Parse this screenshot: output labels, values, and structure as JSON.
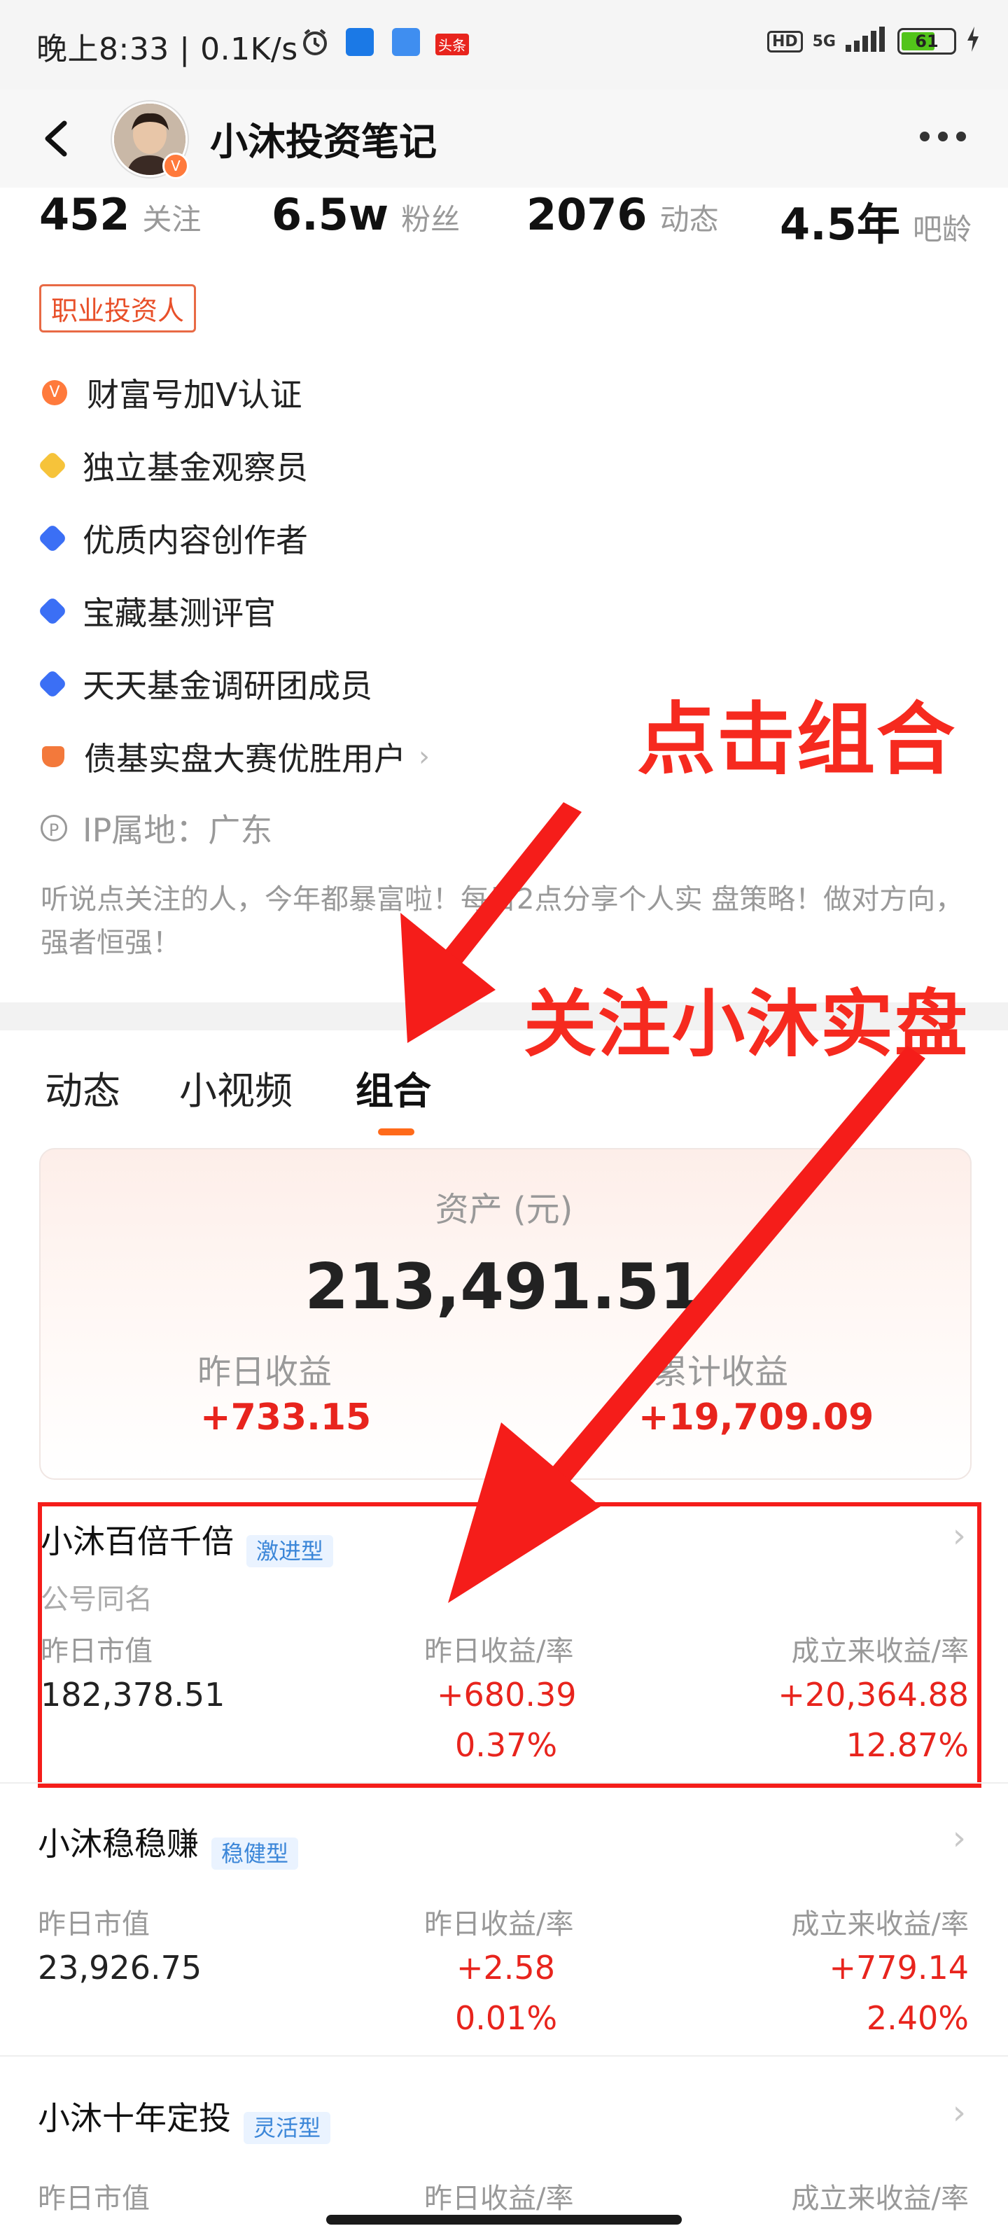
{
  "status_bar": {
    "left_text": "晚上8:33 | 0.1K/s",
    "alarm_icon": "alarm-clock-icon",
    "news_badge": "头条",
    "hd": "HD",
    "network": "5G",
    "battery": "61"
  },
  "nav": {
    "back_icon": "chevron-left-icon",
    "title": "小沐投资笔记",
    "more_icon": "more-horizontal-icon",
    "avatar_badge": "V"
  },
  "stats": [
    {
      "num": "452",
      "label": "关注"
    },
    {
      "num": "6.5w",
      "label": "粉丝"
    },
    {
      "num": "2076",
      "label": "动态"
    },
    {
      "num": "4.5年",
      "label": "吧龄"
    }
  ],
  "tag": "职业投资人",
  "badges": [
    {
      "icon": "v-badge-icon",
      "label": "财富号加V认证"
    },
    {
      "icon": "gold-medal-icon",
      "label": "独立基金观察员"
    },
    {
      "icon": "blue-check-icon",
      "label": "优质内容创作者"
    },
    {
      "icon": "blue-check-icon",
      "label": "宝藏基测评官"
    },
    {
      "icon": "blue-check-icon",
      "label": "天天基金调研团成员"
    },
    {
      "icon": "trophy-icon",
      "label": "债基实盘大赛优胜用户"
    }
  ],
  "ip": {
    "icon_text": "P",
    "label": "IP属地：广东"
  },
  "bio": "听说点关注的人，今年都暴富啦！每日2点分享个人实 盘策略！做对方向，强者恒强！",
  "tabs": [
    "动态",
    "小视频",
    "组合"
  ],
  "asset": {
    "label": "资产 (元)",
    "total": "213,491.51",
    "yesterday_label": "昨日收益",
    "yesterday_value": "+733.15",
    "cumulative_label": "累计收益",
    "cumulative_value": "+19,709.09"
  },
  "portfolio_headers": {
    "col1": "昨日市值",
    "col2": "昨日收益/率",
    "col3": "成立来收益/率"
  },
  "portfolios": [
    {
      "name": "小沐百倍千倍",
      "type": "激进型",
      "desc": "公号同名",
      "market_value": "182,378.51",
      "yesterday_gain": "+680.39",
      "yesterday_rate": "0.37%",
      "total_gain": "+20,364.88",
      "total_rate": "12.87%"
    },
    {
      "name": "小沐稳稳赚",
      "type": "稳健型",
      "market_value": "23,926.75",
      "yesterday_gain": "+2.58",
      "yesterday_rate": "0.01%",
      "total_gain": "+779.14",
      "total_rate": "2.40%"
    },
    {
      "name": "小沐十年定投",
      "type": "灵活型"
    }
  ],
  "annotations": {
    "click_group": "点击组合",
    "follow_text": "关注小沐实盘"
  },
  "colors": {
    "accent_orange": "#ff6a1a",
    "gain_red": "#e8241d",
    "annotation_red": "#f62a1f",
    "type_blue": "#3b86d8"
  }
}
